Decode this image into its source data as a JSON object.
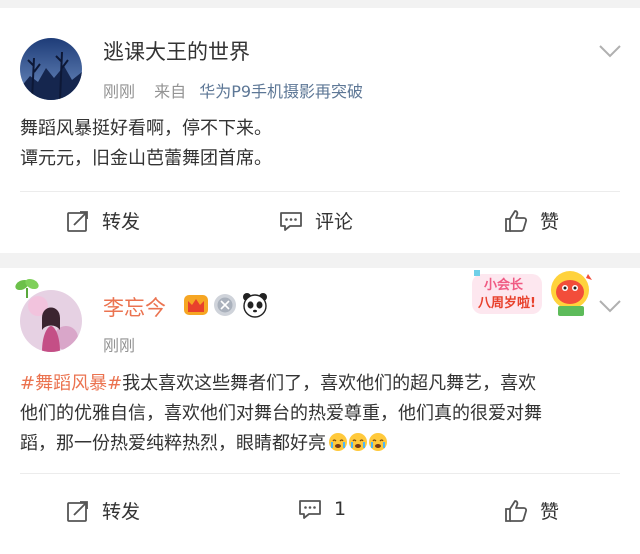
{
  "posts": [
    {
      "username": "逃课大王的世界",
      "time": "刚刚",
      "source_prefix": "来自",
      "source": "华为P9手机摄影再突破",
      "lines": [
        "舞蹈风暴挺好看啊，停不下来。",
        "谭元元，旧金山芭蕾舞团首席。"
      ],
      "actions": {
        "repost": "转发",
        "comment": "评论",
        "like": "赞"
      }
    },
    {
      "username": "李忘今",
      "time": "刚刚",
      "topic": "#舞蹈风暴#",
      "line1_rest": "我太喜欢这些舞者们了，喜欢他们的超凡舞艺，喜欢",
      "line2": "他们的优雅自信，喜欢他们对舞台的热爱尊重，他们真的很爱对舞",
      "line3": "蹈，那一份热爱纯粹热烈，眼睛都好亮",
      "badge_text_1": "小会长",
      "badge_text_2": "八周岁啦!",
      "actions": {
        "repost": "转发",
        "comment": "1",
        "like": "赞"
      }
    }
  ],
  "colors": {
    "accent": "#eb7350",
    "link": "#5d7796",
    "meta": "#939393",
    "bg": "#f2f2f2"
  },
  "icons": [
    "chevron-down-icon",
    "repost-icon",
    "comment-icon",
    "like-icon",
    "crown-icon",
    "medal-icon",
    "panda-icon",
    "crying-emoji-icon"
  ]
}
